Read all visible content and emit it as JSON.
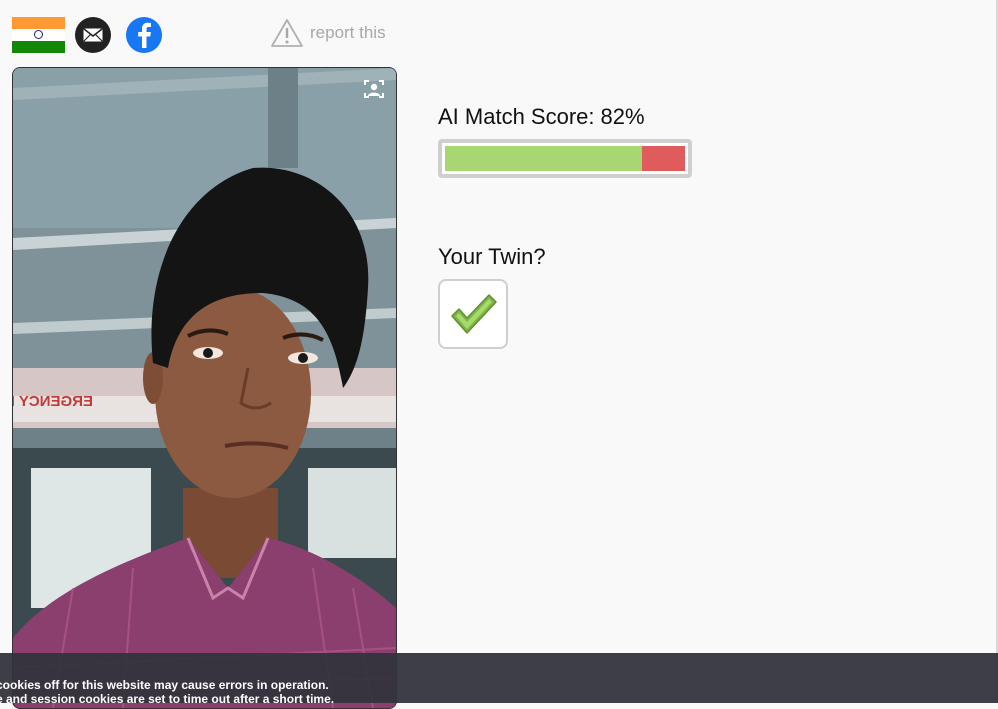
{
  "header": {
    "flag": {
      "name": "india-flag",
      "colors": [
        "#ff9933",
        "#ffffff",
        "#138808"
      ]
    },
    "mail_icon": "email-icon",
    "facebook_icon": "facebook-icon",
    "report_icon": "warning-triangle-icon",
    "report_label": "report this"
  },
  "photo": {
    "description_icon": "face-recognition-icon",
    "sign_text": "ERGENCY EX"
  },
  "match": {
    "label": "AI Match Score:",
    "value_text": "82%",
    "score": 0.82,
    "match_color": "#a8d672",
    "rest_color": "#e05c5c"
  },
  "twin": {
    "label": "Your Twin?",
    "checked": true,
    "check_icon": "checkmark-icon",
    "check_color": "#9cd35a"
  },
  "cookie_banner": {
    "line1": "cookies off for this website may cause errors in operation.",
    "line2": "e and session cookies are set to time out after a short time."
  }
}
